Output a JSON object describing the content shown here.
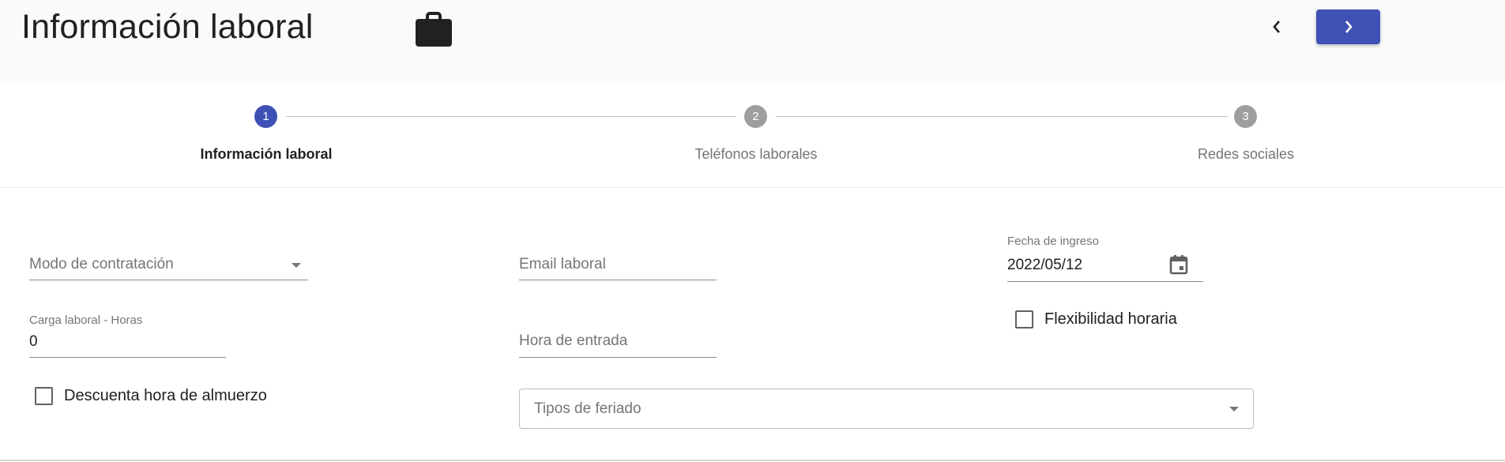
{
  "header": {
    "title": "Información laboral",
    "briefcase_icon": "briefcase-icon",
    "prev_icon": "chevron-left-icon",
    "next_icon": "chevron-right-icon"
  },
  "stepper": {
    "steps": [
      {
        "number": "1",
        "label": "Información laboral",
        "state": "active"
      },
      {
        "number": "2",
        "label": "Teléfonos laborales",
        "state": "inactive"
      },
      {
        "number": "3",
        "label": "Redes sociales",
        "state": "inactive"
      }
    ]
  },
  "form": {
    "modo_contratacion": {
      "placeholder": "Modo de contratación"
    },
    "email_laboral": {
      "placeholder": "Email laboral"
    },
    "fecha_ingreso": {
      "label": "Fecha de ingreso",
      "value": "2022/05/12",
      "icon": "calendar-icon"
    },
    "carga_laboral": {
      "label": "Carga laboral - Horas",
      "value": "0"
    },
    "hora_entrada": {
      "placeholder": "Hora de entrada"
    },
    "flexibilidad_horaria": {
      "label": "Flexibilidad horaria",
      "checked": false
    },
    "descuenta_almuerzo": {
      "label": "Descuenta hora de almuerzo",
      "checked": false
    },
    "tipos_feriado": {
      "placeholder": "Tipos de feriado"
    }
  },
  "colors": {
    "primary": "#3f51b5",
    "inactive_step": "#9e9e9e",
    "header_bg": "#fafafa"
  }
}
